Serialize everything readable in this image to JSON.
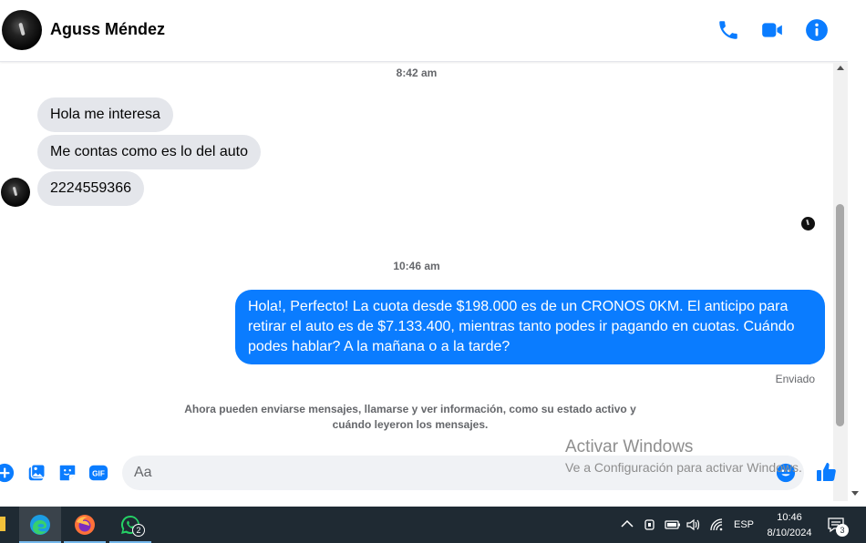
{
  "header": {
    "contact_name": "Aguss Méndez",
    "icons": [
      "phone-icon",
      "video-camera-icon",
      "info-icon"
    ]
  },
  "chat": {
    "timestamp_1": "8:42 am",
    "incoming": [
      "Hola me interesa",
      "Me contas como es lo del auto",
      "2224559366"
    ],
    "timestamp_2": "10:46 am",
    "outgoing": "Hola!, Perfecto! La cuota desde $198.000 es de un CRONOS 0KM. El anticipo para retirar el auto es de $7.133.400, mientras tanto podes ir pagando en cuotas. Cuándo podes hablar? A la mañana o a la tarde?",
    "sent_status": "Enviado",
    "notice": "Ahora pueden enviarse mensajes, llamarse y ver información, como su estado activo y cuándo leyeron los mensajes."
  },
  "composer": {
    "placeholder": "Aa",
    "gif_label": "GIF",
    "icons": [
      "plus-icon",
      "image-icon",
      "sticker-icon",
      "gif-icon",
      "emoji-icon",
      "thumbs-up-icon"
    ]
  },
  "watermark": {
    "title": "Activar Windows",
    "subtitle": "Ve a Configuración para activar Windows."
  },
  "taskbar": {
    "apps": [
      "edge-icon",
      "firefox-icon",
      "whatsapp-icon"
    ],
    "whatsapp_badge": "2",
    "language": "ESP",
    "time": "10:46",
    "date": "8/10/2024",
    "notification_count": "3"
  },
  "colors": {
    "accent": "#0a7cff",
    "incoming_bubble": "#e4e6eb",
    "taskbar": "#1f2a33"
  }
}
